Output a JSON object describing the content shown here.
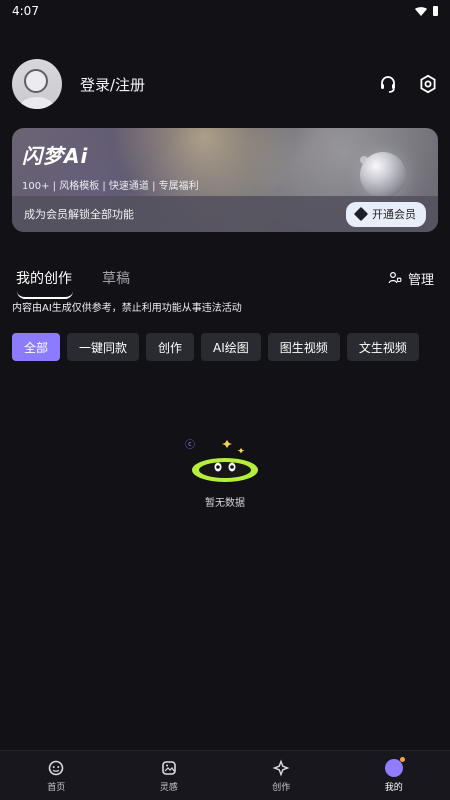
{
  "status": {
    "time": "4:07"
  },
  "profile": {
    "login_text": "登录/注册"
  },
  "vip_card": {
    "brand": "闪梦Ai",
    "features": "100+ | 风格模板 | 快速通道 | 专属福利",
    "cta_text": "成为会员解锁全部功能",
    "button_label": "开通会员"
  },
  "tabs": [
    {
      "label": "我的创作"
    },
    {
      "label": "草稿"
    }
  ],
  "manage_label": "管理",
  "notice": "内容由AI生成仅供参考，禁止利用功能从事违法活动",
  "filters": [
    {
      "label": "全部"
    },
    {
      "label": "一键同款"
    },
    {
      "label": "创作"
    },
    {
      "label": "AI绘图"
    },
    {
      "label": "图生视频"
    },
    {
      "label": "文生视频"
    }
  ],
  "empty": {
    "text": "暂无数据"
  },
  "bottom_nav": [
    {
      "label": "首页",
      "icon": "home-icon"
    },
    {
      "label": "灵感",
      "icon": "inspiration-icon"
    },
    {
      "label": "创作",
      "icon": "create-icon"
    },
    {
      "label": "我的",
      "icon": "me-icon"
    }
  ],
  "colors": {
    "background": "#111116",
    "accent": "#8b7cff",
    "chip_bg": "#2a2a31",
    "nav_bg": "#17171d"
  }
}
